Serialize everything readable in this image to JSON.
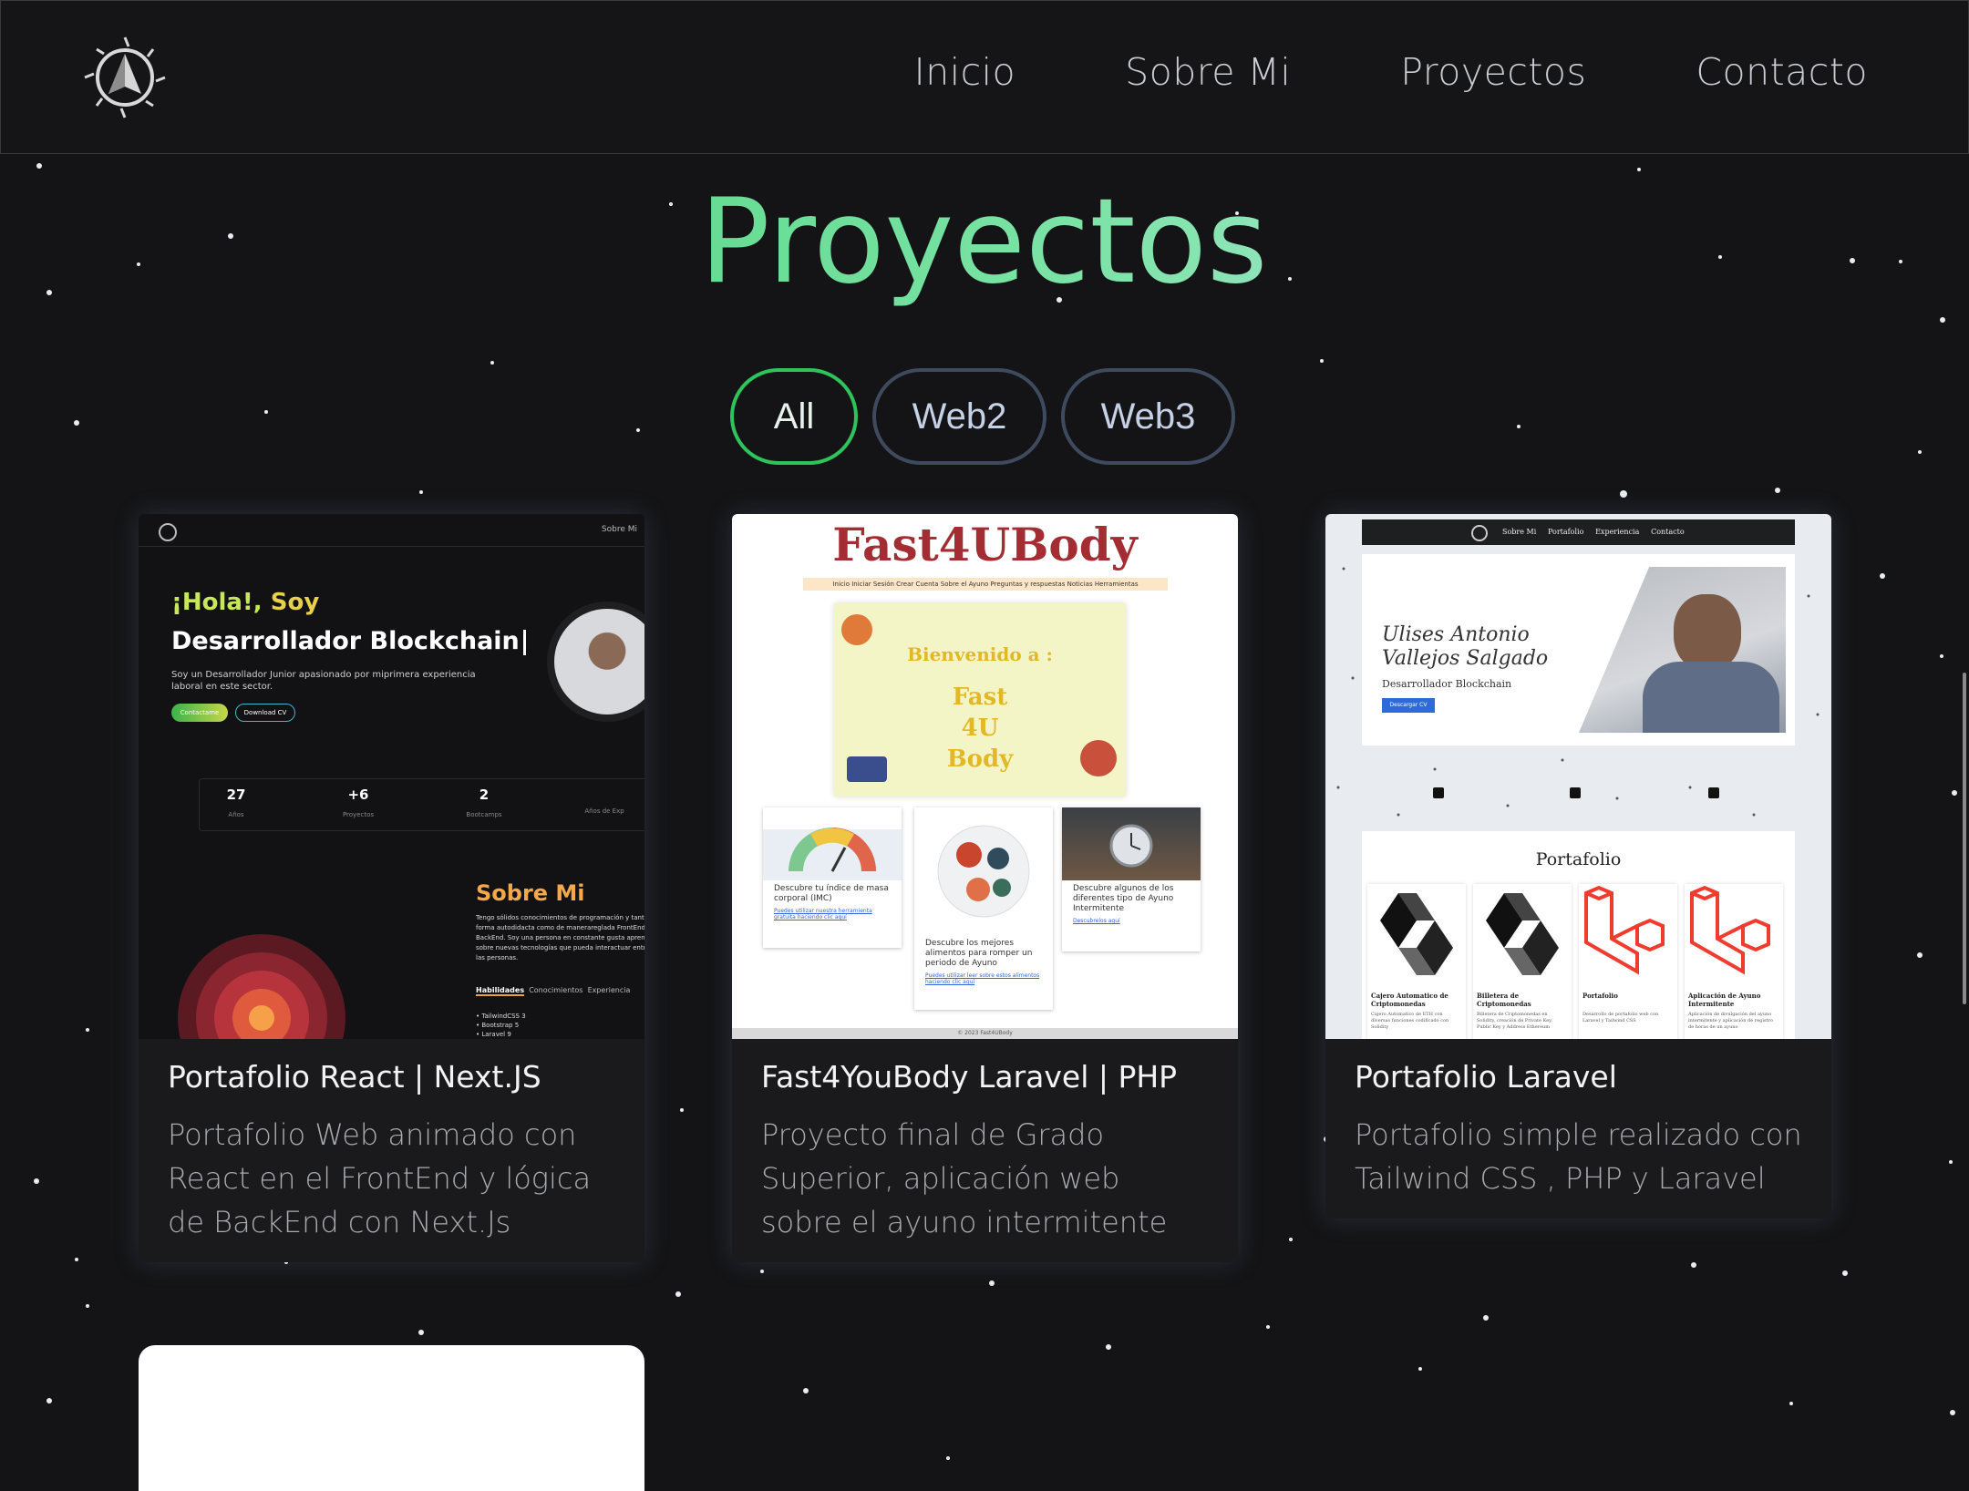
{
  "nav": {
    "links": [
      "Inicio",
      "Sobre Mi",
      "Proyectos",
      "Contacto"
    ]
  },
  "section": {
    "title": "Proyectos"
  },
  "filters": [
    "All",
    "Web2",
    "Web3"
  ],
  "active_filter": "All",
  "accent_colors": {
    "title_start": "#3fcf72",
    "title_end": "#d0e7ff",
    "active_filter": "#2ec35b",
    "filter_border": "#3e4a5e"
  },
  "cards": [
    {
      "title": "Portafolio React | Next.JS",
      "description": "Portafolio Web animado con React en el FrontEnd y lógica de BackEnd con Next.Js",
      "preview": {
        "nav_link": "Sobre Mi",
        "greeting_1": "¡Hola!,",
        "greeting_2": "Soy",
        "role": "Desarrollador Blockchain",
        "intro": "Soy un Desarrollador Junior apasionado por miprimera experiencia laboral en este sector.",
        "button_contact": "Contactame",
        "button_cv": "Download CV",
        "stats": [
          {
            "value": "27",
            "label": "Años"
          },
          {
            "value": "+6",
            "label": "Proyectos"
          },
          {
            "value": "2",
            "label": "Bootcamps"
          },
          {
            "value": "",
            "label": "Años de Exp"
          }
        ],
        "about_title": "Sobre Mi",
        "about_text": "Tengo sólidos conocimientos de programación y tanto de forma autodidacta como de manerareglada FrontEnd y BackEnd. Soy una persona en constante gusta aprender sobre nuevas tecnologías que pueda interactuar entre las personas.",
        "tabs": [
          "Habilidades",
          "Conocimientos",
          "Experiencia"
        ],
        "skills": [
          "TailwindCSS 3",
          "Bootstrap 5",
          "Laravel 9"
        ]
      }
    },
    {
      "title": "Fast4YouBody Laravel | PHP",
      "description": "Proyecto final de Grado Superior, aplicación web sobre el ayuno intermitente",
      "preview": {
        "brand": "Fast4UBody",
        "menu": "Inicio  Iniciar Sesión  Crear Cuenta  Sobre el Ayuno  Preguntas y respuestas  Noticias  Herramientas",
        "banner_1": "Bienvenido a :",
        "banner_2": "Fast",
        "banner_3": "4U",
        "banner_4": "Body",
        "tiles": [
          {
            "text": "Descubre tu índice de masa corporal (IMC)",
            "link": "Puedes utilizar nuestra herramienta gratuita haciendo clic aquí"
          },
          {
            "text": "Descubre los mejores alimentos para romper un periodo de Ayuno",
            "link": "Puedes utilizar leer sobre estos alimentos haciendo clic aquí"
          },
          {
            "text": "Descubre algunos de los diferentes tipo de Ayuno Intermitente",
            "link": "Descubrelos aquí"
          }
        ],
        "footer": "© 2023 Fast4UBody"
      }
    },
    {
      "title": "Portafolio Laravel",
      "description": "Portafolio simple realizado con Tailwind CSS , PHP y Laravel",
      "preview": {
        "nav": "Sobre Mi     Portafolio     Experiencia     Contacto",
        "name_1": "Ulises Antonio",
        "name_2": "Vallejos Salgado",
        "role": "Desarrollador Blockchain",
        "button": "Descargar CV",
        "section": "Portafolio",
        "items": [
          {
            "title": "Cajero Automatico de Criptomonedas",
            "text": "Cajero Automatico de ETH con diversas funciones codificado con Solidity"
          },
          {
            "title": "Billetera de Criptomonedas",
            "text": "Billetera de Criptomonedas en Solidity, creación de Private Key, Public Key y Address Ethereum"
          },
          {
            "title": "Portafolio",
            "text": "Desarrollo de portafolio web con Laravel y Tailwind CSS"
          },
          {
            "title": "Aplicación de Ayuno Intermitente",
            "text": "Aplicación de divulgación del ayuno intermitente y aplicación de registro de horas de un ayuno"
          }
        ]
      }
    }
  ]
}
